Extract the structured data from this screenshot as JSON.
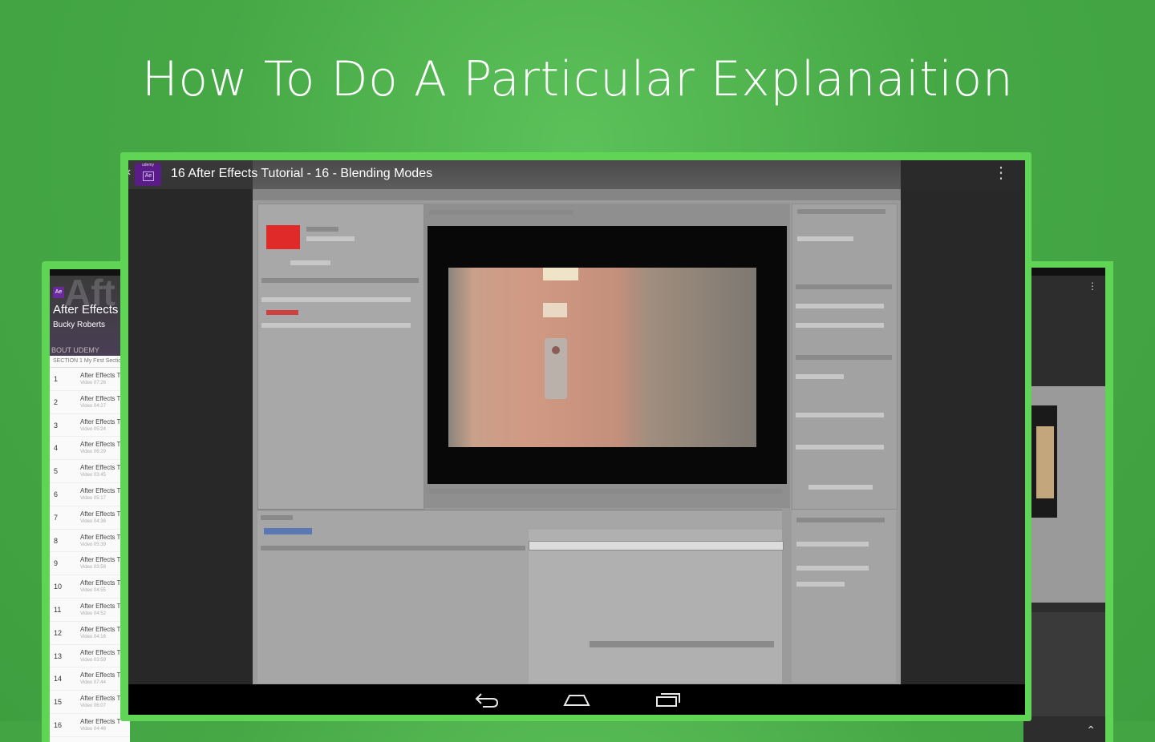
{
  "headline": "How To Do A Particular Explanaition",
  "left_preview": {
    "watermark": "Aft",
    "app_logo": "Ae",
    "course_title": "After Effects",
    "author": "Bucky Roberts",
    "tab_label": "BOUT UDEMY",
    "section_label": "SECTION 1  My First Sectic",
    "lectures": [
      {
        "num": "1",
        "title": "After Effects T",
        "sub": "Video 07:26"
      },
      {
        "num": "2",
        "title": "After Effects T",
        "sub": "Video 04:27"
      },
      {
        "num": "3",
        "title": "After Effects T",
        "sub": "Video 05:24"
      },
      {
        "num": "4",
        "title": "After Effects T",
        "sub": "Video 06:29"
      },
      {
        "num": "5",
        "title": "After Effects T",
        "sub": "Video 03:45"
      },
      {
        "num": "6",
        "title": "After Effects T",
        "sub": "Video 05:17"
      },
      {
        "num": "7",
        "title": "After Effects T",
        "sub": "Video 04:36"
      },
      {
        "num": "8",
        "title": "After Effects T",
        "sub": "Video 05:39"
      },
      {
        "num": "9",
        "title": "After Effects T",
        "sub": "Video 03:58"
      },
      {
        "num": "10",
        "title": "After Effects T",
        "sub": "Video 04:55"
      },
      {
        "num": "11",
        "title": "After Effects T",
        "sub": "Video 04:52"
      },
      {
        "num": "12",
        "title": "After Effects T",
        "sub": "Video 04:16"
      },
      {
        "num": "13",
        "title": "After Effects T",
        "sub": "Video 03:59"
      },
      {
        "num": "14",
        "title": "After Effects T",
        "sub": "Video 07:44"
      },
      {
        "num": "15",
        "title": "After Effects T",
        "sub": "Video 06:07"
      },
      {
        "num": "16",
        "title": "After Effects T",
        "sub": "Video 04:46"
      }
    ]
  },
  "player": {
    "app_icon_tag": "udemy",
    "app_icon_text": "Ae",
    "title": "16  After Effects Tutorial - 16 - Blending Modes",
    "menu_icon": "more-vert-icon",
    "back_icon": "chevron-left-icon"
  },
  "nav": {
    "back_icon": "back-icon",
    "home_icon": "home-icon",
    "recent_icon": "recent-apps-icon"
  },
  "colors": {
    "background": "#45a845",
    "device_frame": "#5fd455",
    "app_icon": "#5a1c86",
    "accent_red": "#e02a2a"
  }
}
